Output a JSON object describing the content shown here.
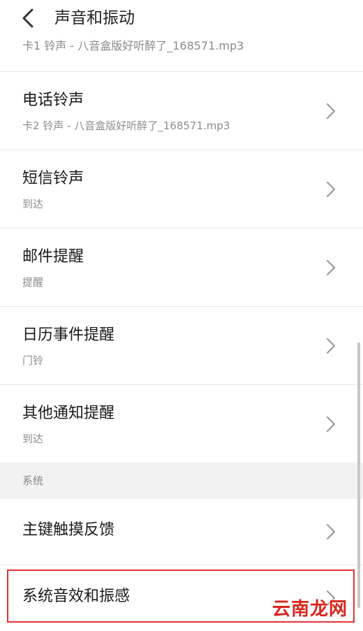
{
  "header": {
    "back_icon": "chevron-left-icon",
    "title": "声音和振动"
  },
  "partial_row": {
    "subtitle": "卡1 铃声 - 八音盒版好听醉了_168571.mp3"
  },
  "rows": [
    {
      "title": "电话铃声",
      "subtitle": "卡2 铃声 - 八音盒版好听醉了_168571.mp3"
    },
    {
      "title": "短信铃声",
      "subtitle": "到达"
    },
    {
      "title": "邮件提醒",
      "subtitle": "提醒"
    },
    {
      "title": "日历事件提醒",
      "subtitle": "门铃"
    },
    {
      "title": "其他通知提醒",
      "subtitle": "到达"
    }
  ],
  "section_system": {
    "label": "系统",
    "rows": [
      {
        "title": "主键触摸反馈"
      },
      {
        "title": "系统音效和振感"
      }
    ]
  },
  "highlight_color": "#e23434",
  "watermark": "云南龙网"
}
